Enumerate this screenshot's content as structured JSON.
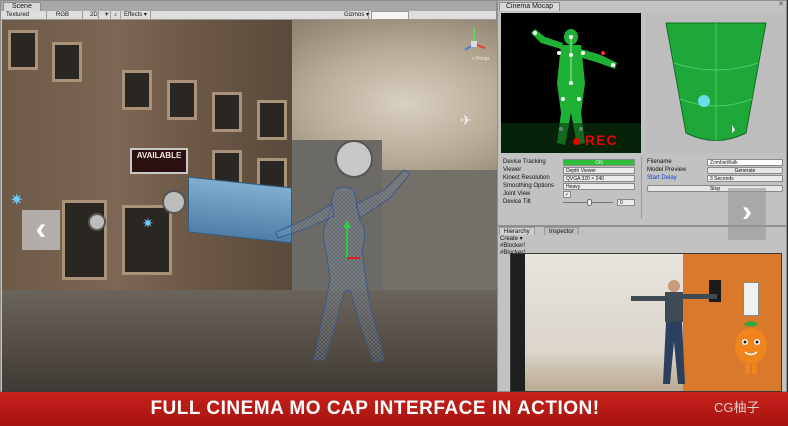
{
  "scene": {
    "tab_label": "Scene",
    "toolbar": {
      "shading": "Textured",
      "render_mode": "RGB",
      "mode_2d": "2D",
      "effects": "Effects",
      "gizmos": "Gizmos"
    },
    "perspective_label": "< Persp",
    "shop_sign": {
      "line1": "AVAILABLE",
      "line2": ""
    }
  },
  "mocap": {
    "tab_label": "Cinema Mocap",
    "rec_label": "REC",
    "properties": [
      {
        "label": "Device Tracking",
        "value": "ON"
      },
      {
        "label": "Viewer",
        "value": "Depth Viewer"
      },
      {
        "label": "Kinect Resolution",
        "value": "QVGA 320 × 240"
      },
      {
        "label": "Smoothing Options",
        "value": "Heavy"
      },
      {
        "label": "Joint View",
        "value": "✓"
      },
      {
        "label": "Device Tilt",
        "value": "0"
      }
    ],
    "filename_label": "Filename",
    "filename_value": "ZombieWalk",
    "model_preview_label": "Model Preview",
    "generate_label": "Generate",
    "start_delay_label": "Start Delay",
    "start_delay_value": "3 Seconds",
    "stop_label": "Stop"
  },
  "hierarchy": {
    "tab_label": "Hierarchy",
    "inspector_label": "Inspector",
    "create_label": "Create",
    "items": [
      "#Blocker!",
      "#Blocker!"
    ]
  },
  "banner": {
    "text": "FULL CINEMA MO CAP INTERFACE IN ACTION!",
    "watermark": "CG柚子"
  },
  "colors": {
    "banner_red": "#b81a14",
    "depth_green": "#22c43a",
    "radar_green": "#1fa83a",
    "rec_red": "#e00000"
  }
}
